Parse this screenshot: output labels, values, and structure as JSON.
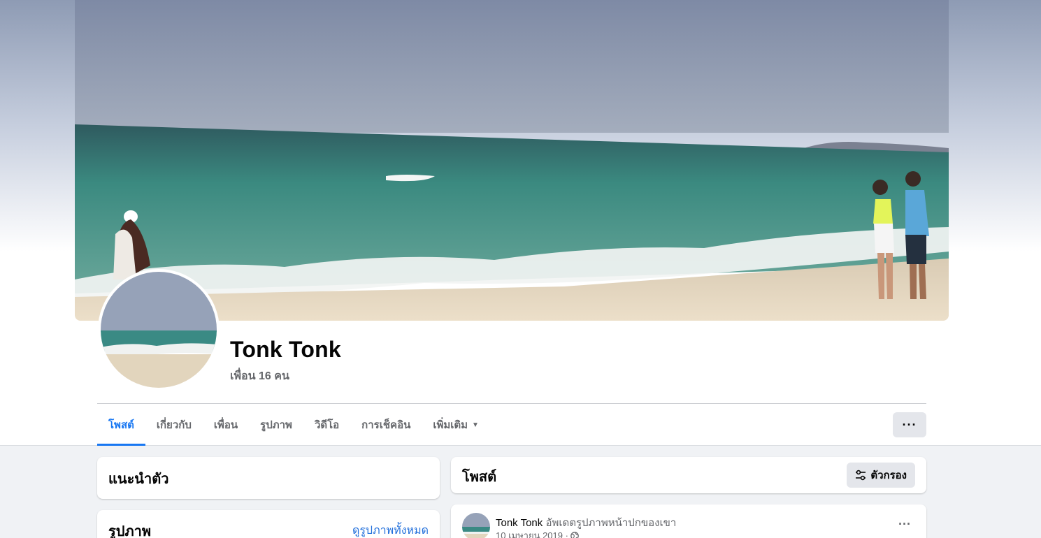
{
  "profile": {
    "name": "Tonk Tonk",
    "friends": "เพื่อน 16 คน"
  },
  "tabs": [
    {
      "label": "โพสต์",
      "active": true
    },
    {
      "label": "เกี่ยวกับ"
    },
    {
      "label": "เพื่อน"
    },
    {
      "label": "รูปภาพ"
    },
    {
      "label": "วิดีโอ"
    },
    {
      "label": "การเช็คอิน"
    },
    {
      "label": "เพิ่มเติม"
    }
  ],
  "more_button": "···",
  "intro": {
    "title": "แนะนำตัว"
  },
  "photos": {
    "title": "รูปภาพ",
    "see_all": "ดูรูปภาพทั้งหมด"
  },
  "posts": {
    "title": "โพสต์",
    "filter_label": "ตัวกรอง"
  },
  "post": {
    "author": "Tonk Tonk",
    "action": "อัพเดตรูปภาพหน้าปกของเขา",
    "date": "10 เมษายน 2019 ·",
    "menu": "···"
  },
  "colors": {
    "accent": "#1877f2",
    "link": "#216fdb",
    "secondary_text": "#65676b"
  },
  "icons": [
    "caret-down-icon",
    "more-dots-icon",
    "filter-sliders-icon",
    "globe-icon"
  ]
}
